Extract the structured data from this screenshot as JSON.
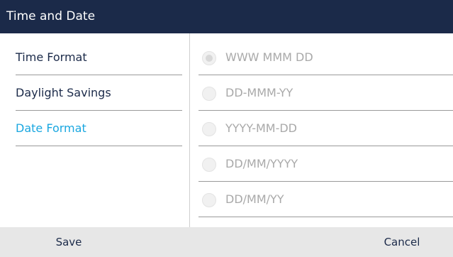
{
  "header": {
    "title": "Time and Date"
  },
  "menu": {
    "items": [
      {
        "label": "Time Format",
        "active": false
      },
      {
        "label": "Daylight Savings",
        "active": false
      },
      {
        "label": "Date Format",
        "active": true
      }
    ]
  },
  "options": {
    "items": [
      {
        "label": "WWW MMM DD",
        "selected": true
      },
      {
        "label": "DD-MMM-YY",
        "selected": false
      },
      {
        "label": "YYYY-MM-DD",
        "selected": false
      },
      {
        "label": "DD/MM/YYYY",
        "selected": false
      },
      {
        "label": "DD/MM/YY",
        "selected": false
      }
    ]
  },
  "softkeys": {
    "save": "Save",
    "cancel": "Cancel"
  },
  "colors": {
    "titlebar": "#1b2a49",
    "active": "#1aa7e0",
    "softkey_bar": "#e7e7e7"
  }
}
